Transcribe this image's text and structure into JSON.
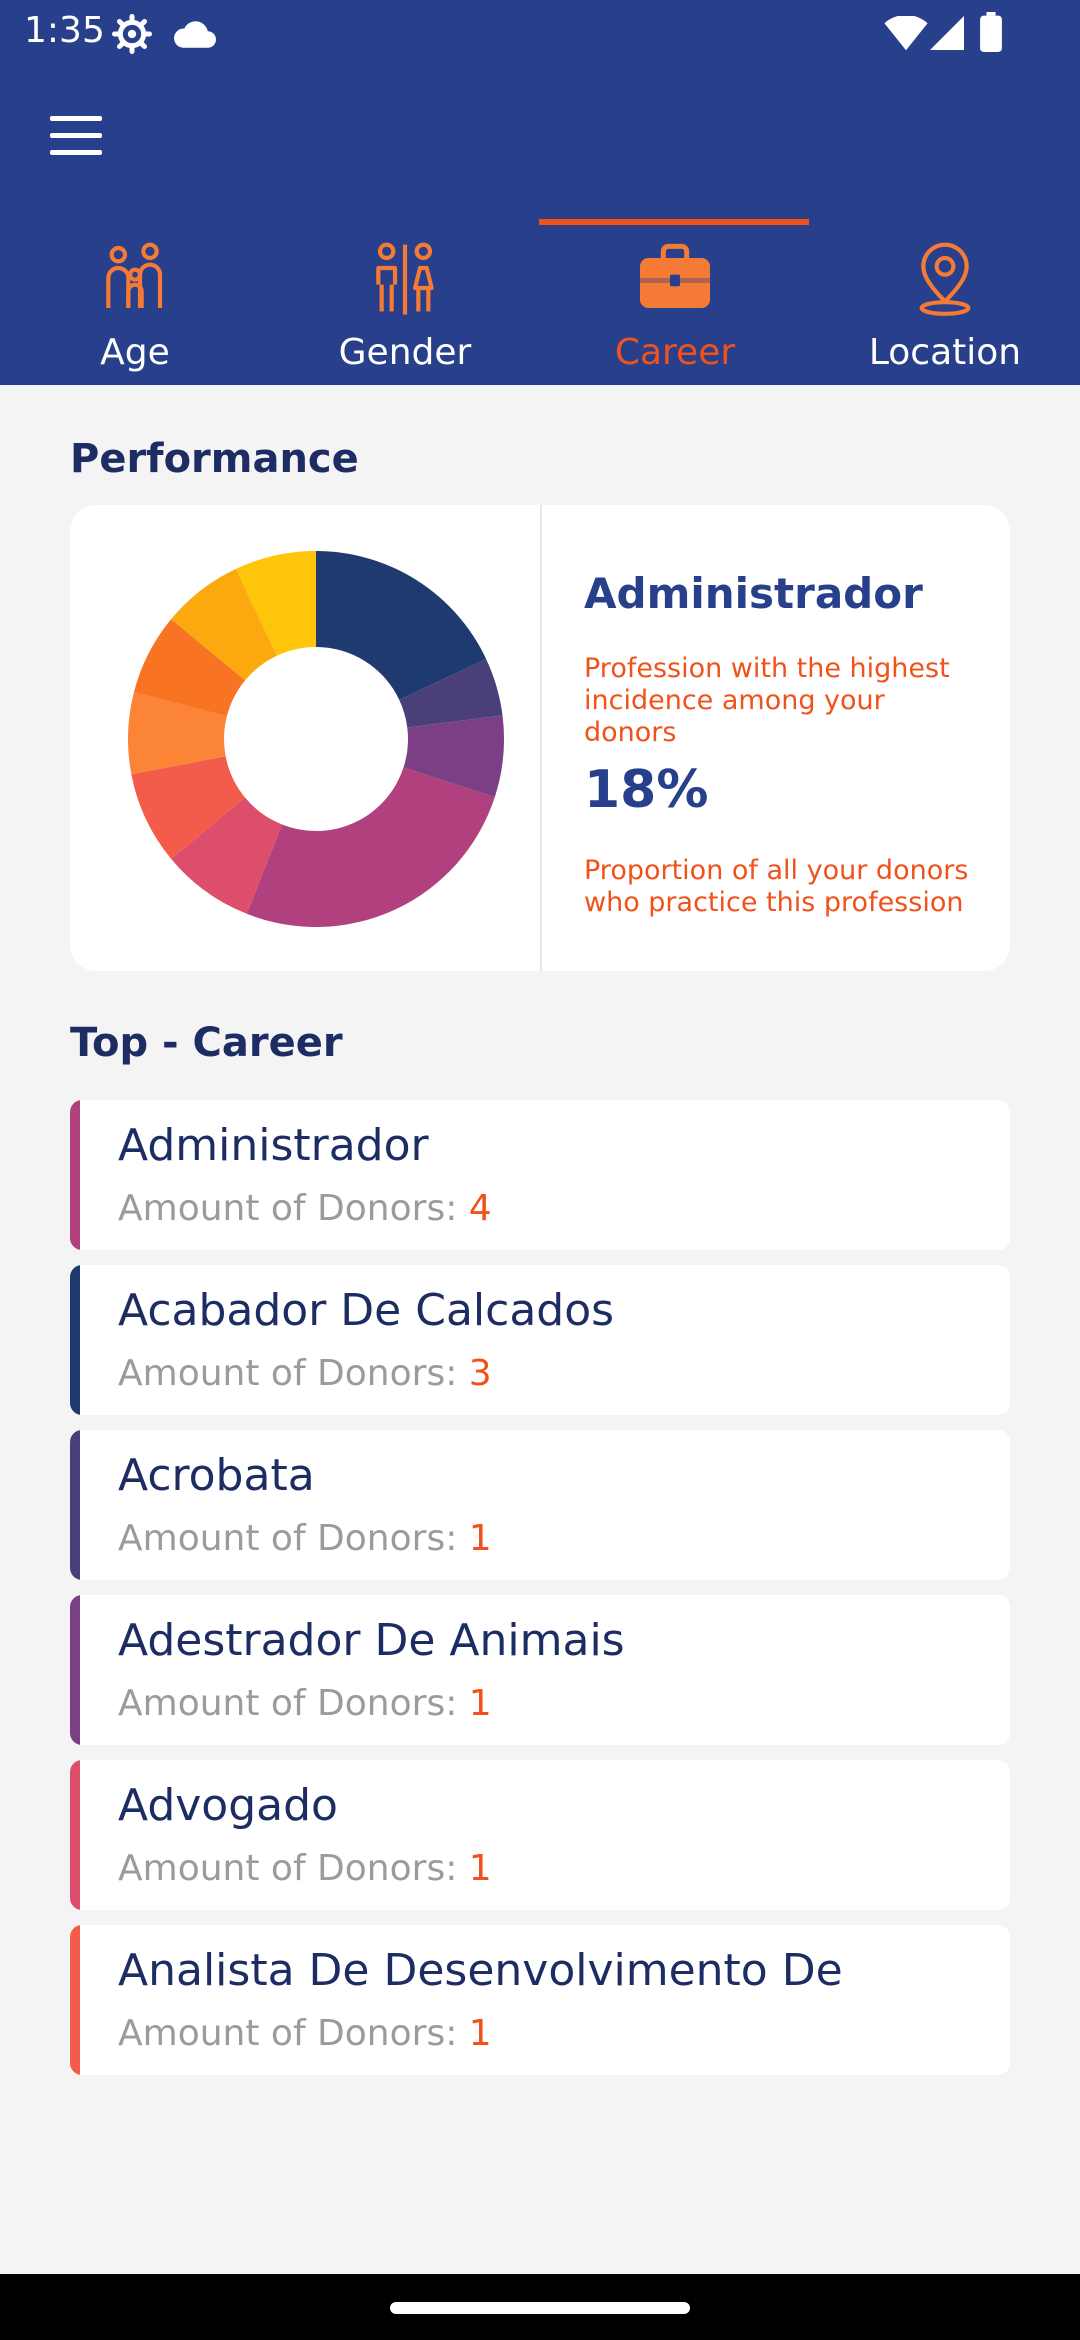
{
  "status": {
    "time": "1:35"
  },
  "tabs": [
    {
      "label": "Age",
      "icon": "family-icon"
    },
    {
      "label": "Gender",
      "icon": "gender-icon"
    },
    {
      "label": "Career",
      "icon": "briefcase-icon",
      "active": true
    },
    {
      "label": "Location",
      "icon": "location-pin-icon"
    }
  ],
  "performance": {
    "title": "Performance",
    "top_profession": "Administrador",
    "top_desc": "Profession with the highest incidence among your donors",
    "percent": "18%",
    "percent_desc": "Proportion of all your donors who practice this profession",
    "donut_segments": [
      {
        "value": 18,
        "color": "#1e3a6e"
      },
      {
        "value": 5,
        "color": "#4b3f7a"
      },
      {
        "value": 7,
        "color": "#7b3f85"
      },
      {
        "value": 26,
        "color": "#b0407e"
      },
      {
        "value": 8,
        "color": "#dd4d6c"
      },
      {
        "value": 8,
        "color": "#f35b4a"
      },
      {
        "value": 7,
        "color": "#fb8436"
      },
      {
        "value": 7,
        "color": "#f87422"
      },
      {
        "value": 7,
        "color": "#fba90f"
      },
      {
        "value": 7,
        "color": "#fec50a"
      }
    ]
  },
  "top_career": {
    "title": "Top - Career",
    "amount_label": "Amount of Donors:",
    "items": [
      {
        "name": "Administrador",
        "count": "4",
        "color": "#b0407e"
      },
      {
        "name": "Acabador De Calcados",
        "count": "3",
        "color": "#1e3a6e"
      },
      {
        "name": "Acrobata",
        "count": "1",
        "color": "#4b3f7a"
      },
      {
        "name": "Adestrador De Animais",
        "count": "1",
        "color": "#7b3f85"
      },
      {
        "name": "Advogado",
        "count": "1",
        "color": "#dd4d6c"
      },
      {
        "name": "Analista De Desenvolvimento De",
        "count": "1",
        "color": "#f35b4a"
      }
    ]
  },
  "colors": {
    "primary": "#283f8c",
    "accent": "#f0521b",
    "dark_text": "#1d2c63"
  }
}
